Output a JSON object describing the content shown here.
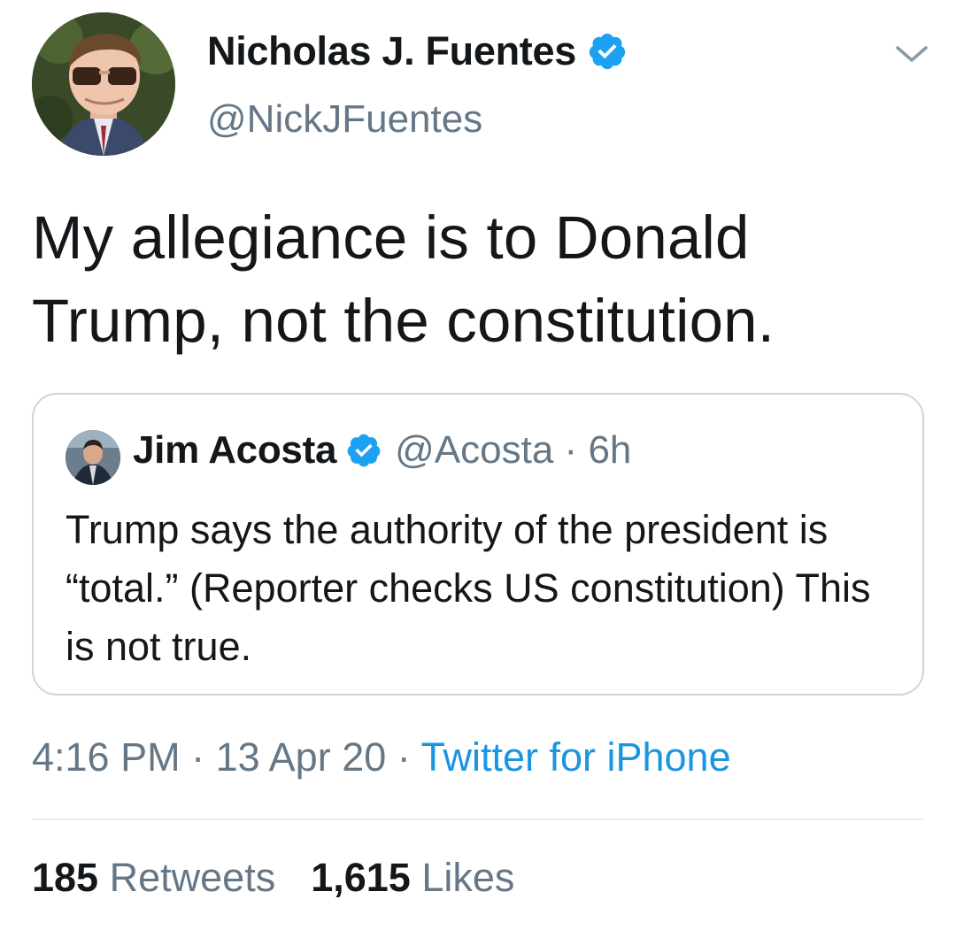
{
  "author": {
    "name": "Nicholas J. Fuentes",
    "handle": "@NickJFuentes",
    "verified": true
  },
  "tweet": {
    "text": "My allegiance is to Donald Trump, not the constitution."
  },
  "quoted_tweet": {
    "name": "Jim Acosta",
    "handle": "@Acosta",
    "separator": " · ",
    "age": "6h",
    "verified": true,
    "text": "Trump says the authority of the president is “total.” (Reporter checks US constitution) This is not true."
  },
  "meta": {
    "time": "4:16 PM",
    "sep1": " · ",
    "date": "13 Apr 20",
    "sep2": " · ",
    "source": "Twitter for iPhone"
  },
  "stats": {
    "retweets_count": "185",
    "retweets_label": "Retweets",
    "likes_count": "1,615",
    "likes_label": "Likes"
  },
  "colors": {
    "verified_blue": "#1da1f2",
    "secondary_text": "#657786",
    "link": "#1b95e0",
    "border": "#ccd6dd"
  },
  "icons": [
    "avatar-photo",
    "verified-badge-icon",
    "chevron-down-icon"
  ]
}
